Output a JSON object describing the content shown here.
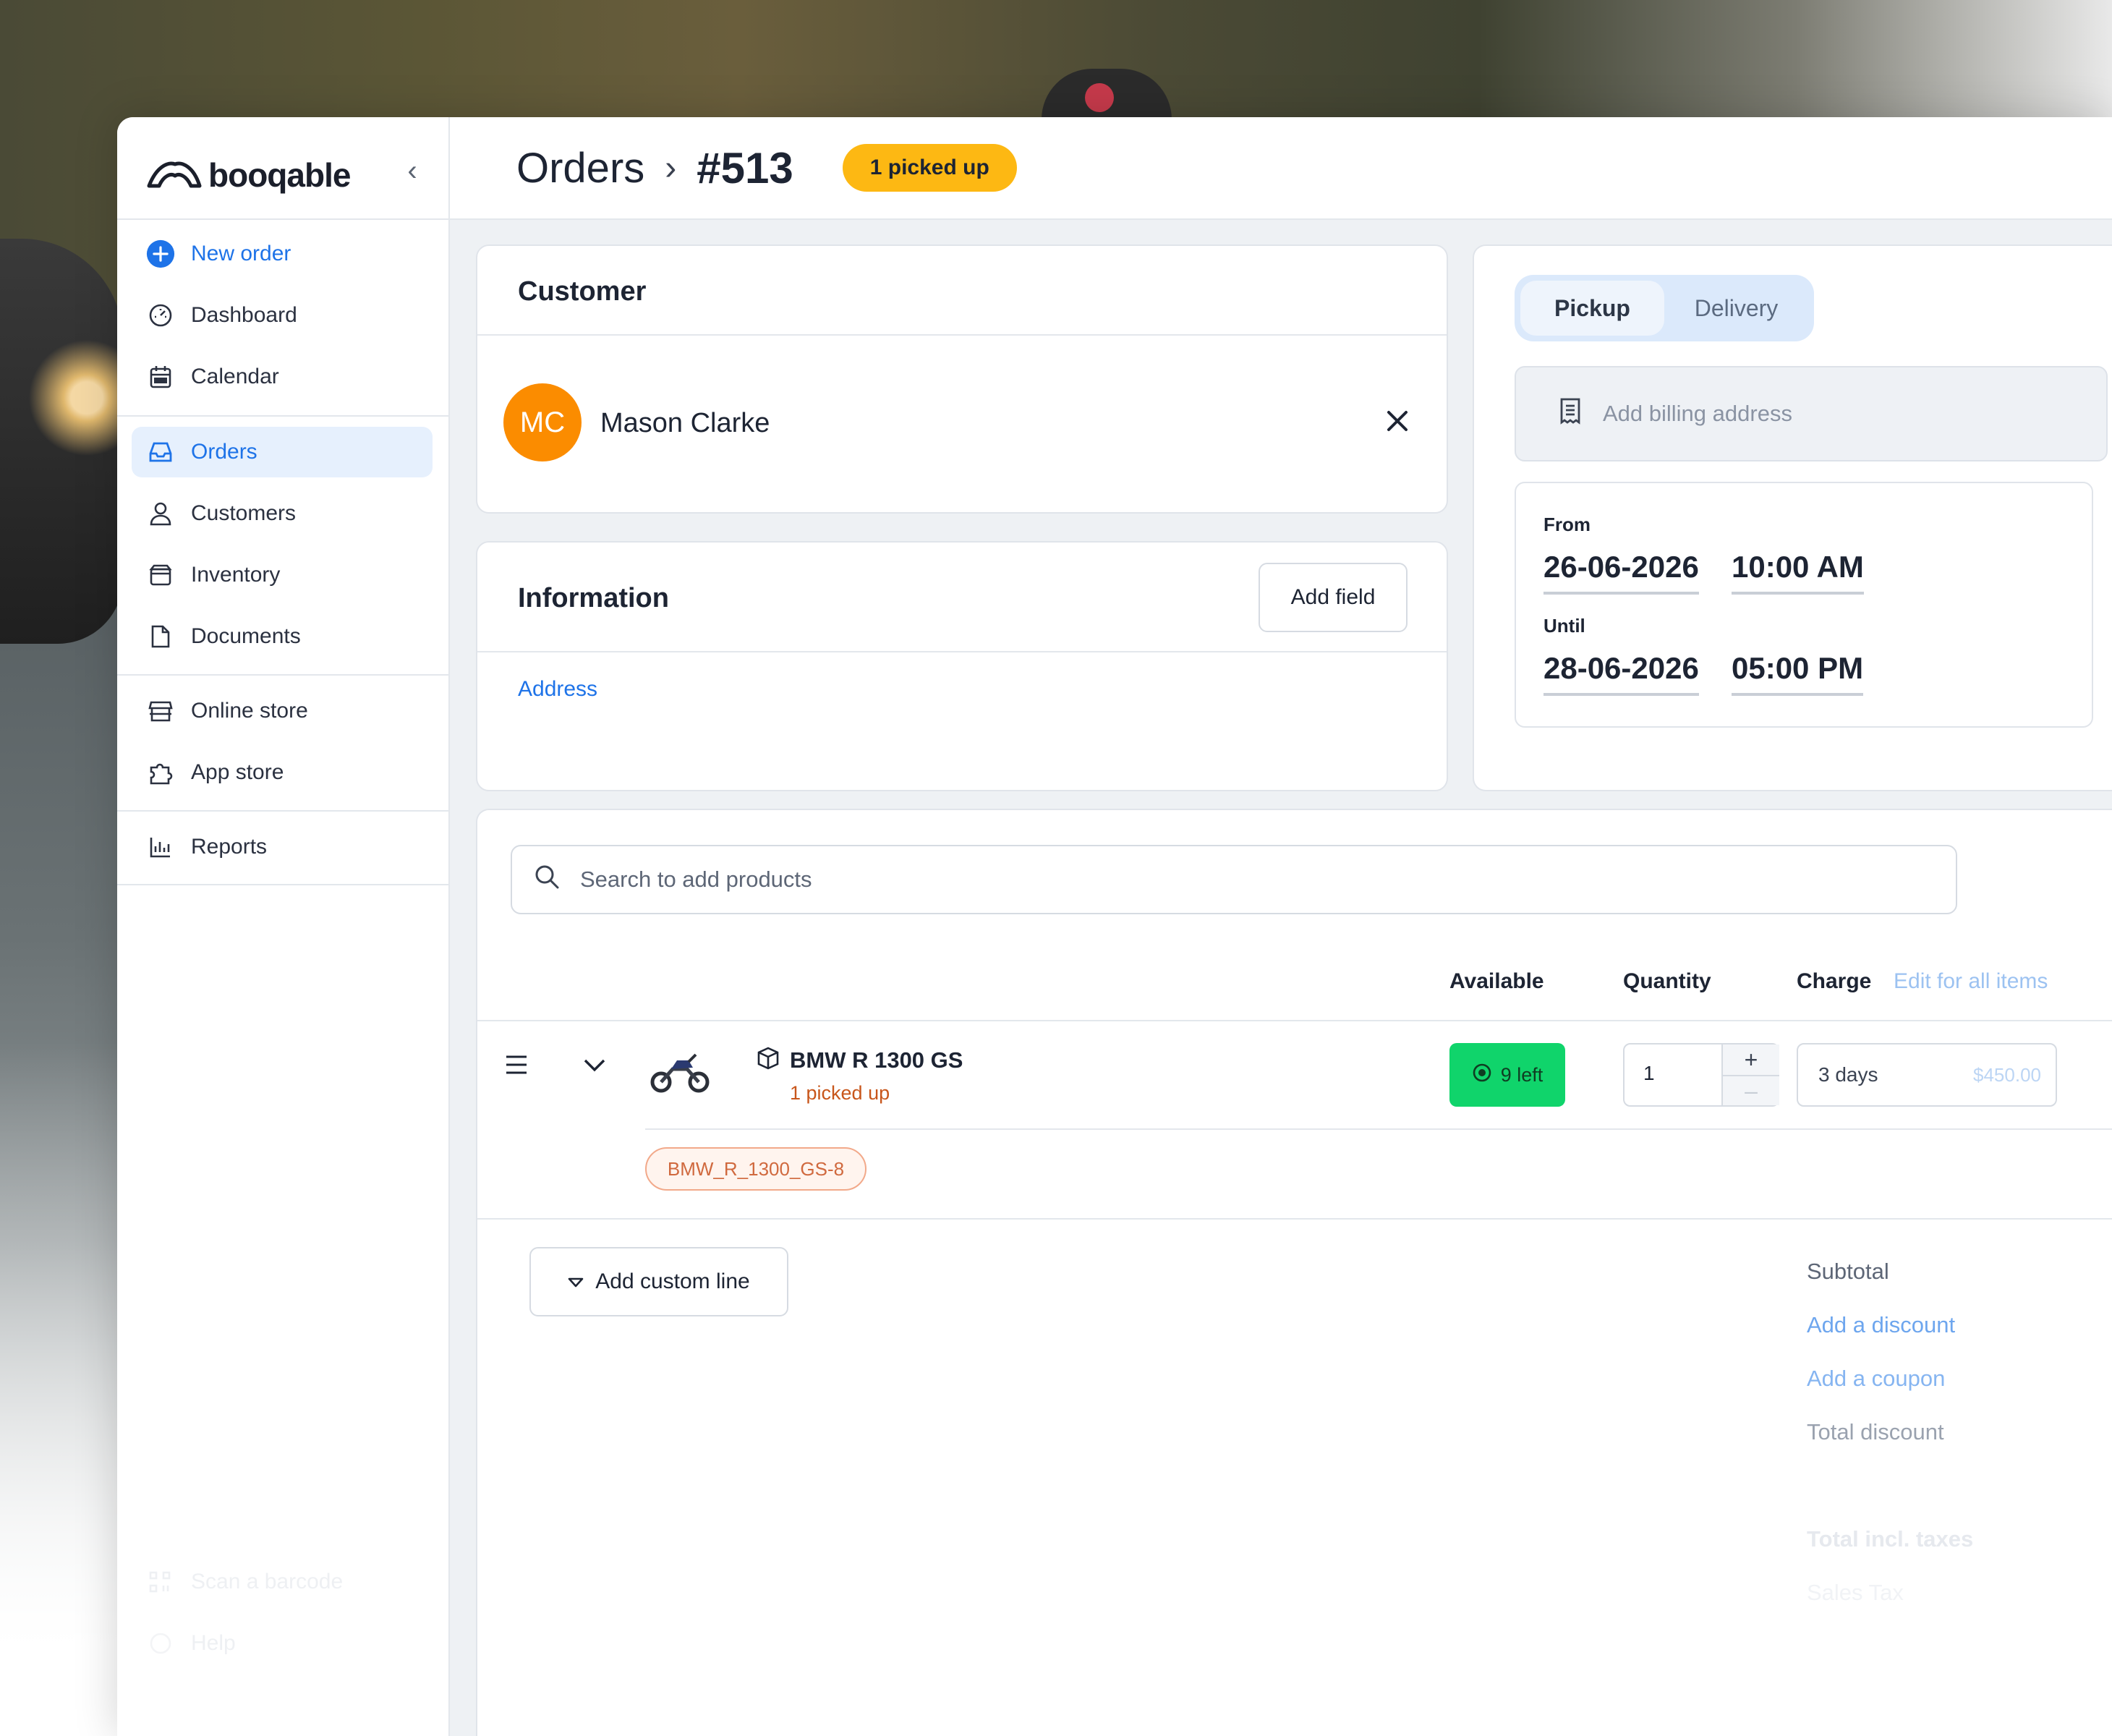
{
  "brand": {
    "name": "booqable"
  },
  "sidebar": {
    "new_order": "New order",
    "items": [
      {
        "label": "Dashboard",
        "icon": "dashboard-icon"
      },
      {
        "label": "Calendar",
        "icon": "calendar-icon"
      },
      {
        "label": "Orders",
        "icon": "inbox-icon",
        "active": true
      },
      {
        "label": "Customers",
        "icon": "user-icon"
      },
      {
        "label": "Inventory",
        "icon": "archive-icon"
      },
      {
        "label": "Documents",
        "icon": "document-icon"
      },
      {
        "label": "Online store",
        "icon": "store-icon"
      },
      {
        "label": "App store",
        "icon": "puzzle-icon"
      },
      {
        "label": "Reports",
        "icon": "chart-icon"
      }
    ],
    "bottom": [
      {
        "label": "Scan a barcode",
        "icon": "barcode-icon"
      },
      {
        "label": "Help",
        "icon": "help-icon"
      }
    ]
  },
  "header": {
    "breadcrumb_root": "Orders",
    "order_number": "#513",
    "status_badge": "1 picked up"
  },
  "customer": {
    "title": "Customer",
    "initials": "MC",
    "name": "Mason Clarke"
  },
  "information": {
    "title": "Information",
    "add_field": "Add field",
    "address_link": "Address"
  },
  "fulfillment": {
    "tabs": [
      "Pickup",
      "Delivery"
    ],
    "active_tab": "Pickup",
    "billing_placeholder": "Add billing address",
    "from_label": "From",
    "from_date": "26-06-2026",
    "from_time": "10:00 AM",
    "until_label": "Until",
    "until_date": "28-06-2026",
    "until_time": "05:00 PM"
  },
  "products": {
    "search_placeholder": "Search to add products",
    "columns": {
      "available": "Available",
      "quantity": "Quantity",
      "charge": "Charge",
      "edit_all": "Edit for all items"
    },
    "lines": [
      {
        "name": "BMW R 1300 GS",
        "status": "1 picked up",
        "available": "9 left",
        "quantity": "1",
        "charge_period": "3 days",
        "charge_amount": "$450.00",
        "identifier": "BMW_R_1300_GS-8"
      }
    ],
    "add_custom_line": "Add custom line"
  },
  "totals": {
    "subtotal": "Subtotal",
    "add_discount": "Add a discount",
    "add_coupon": "Add a coupon",
    "total_discount": "Total discount",
    "total_incl_taxes": "Total incl. taxes",
    "sales_tax": "Sales Tax"
  },
  "colors": {
    "accent": "#1e73e8",
    "badge": "#fdb813",
    "avatar": "#fb8c00",
    "stock": "#10d46b"
  }
}
